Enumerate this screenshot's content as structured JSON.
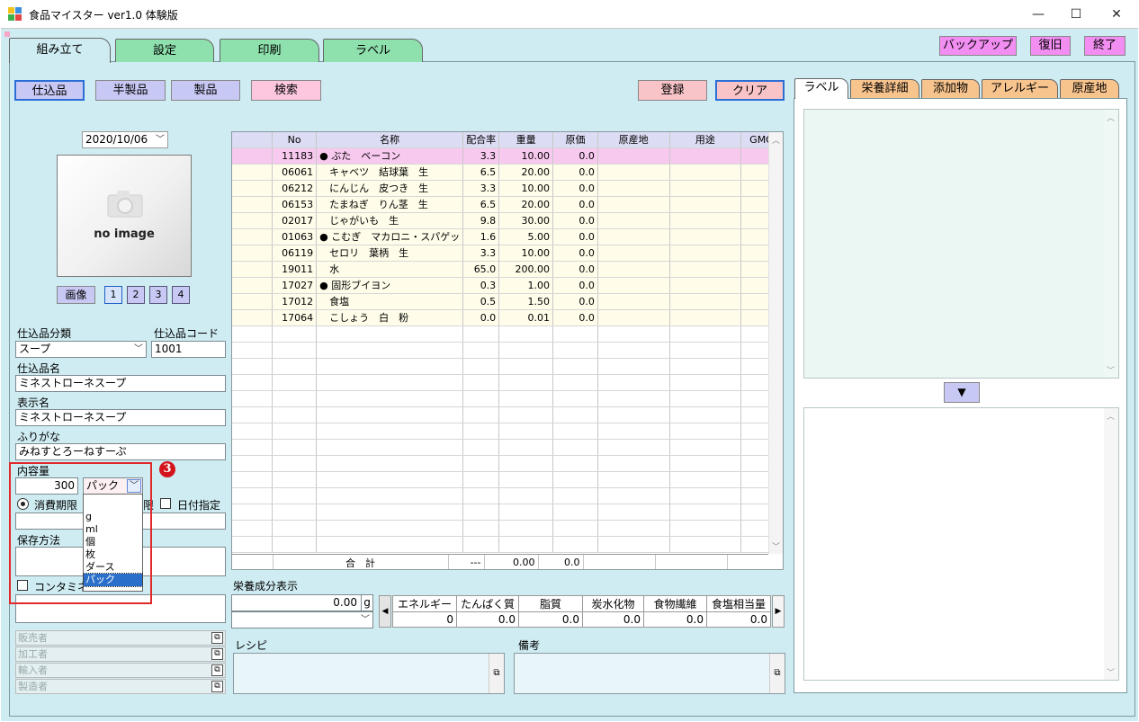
{
  "window": {
    "title": "食品マイスター ver1.0 体験版",
    "minimize": "—",
    "maximize": "☐",
    "close": "✕"
  },
  "tabs": [
    {
      "label": "組み立て",
      "active": true
    },
    {
      "label": "設定"
    },
    {
      "label": "印刷"
    },
    {
      "label": "ラベル"
    }
  ],
  "top_buttons": {
    "backup": "バックアップ",
    "restore": "復旧",
    "exit": "終了"
  },
  "toolbar": {
    "shikomi": "仕込品",
    "hanseihin": "半製品",
    "seihin": "製品",
    "search": "検索",
    "register": "登録",
    "clear": "クリア"
  },
  "date": "2020/10/06",
  "image": {
    "placeholder": "no image",
    "button": "画像",
    "pages": [
      "1",
      "2",
      "3",
      "4"
    ]
  },
  "form": {
    "category_label": "仕込品分類",
    "category_value": "スープ",
    "code_label": "仕込品コード",
    "code_value": "1001",
    "name_label": "仕込品名",
    "name_value": "ミネストローネスープ",
    "display_label": "表示名",
    "display_value": "ミネストローネスープ",
    "furigana_label": "ふりがな",
    "furigana_value": "みねすとろーねすーぷ",
    "content_label": "内容量",
    "content_value": "300",
    "unit_value": "パック",
    "expiry_label": "消費期限",
    "expiry_tail": "限",
    "date_spec_label": "日付指定",
    "storage_label": "保存方法",
    "contam_label": "コンタミネ",
    "marker": "3"
  },
  "unit_options": [
    "g",
    "ml",
    "個",
    "枚",
    "ダース",
    "パック"
  ],
  "roles": [
    "販売者",
    "加工者",
    "輸入者",
    "製造者"
  ],
  "grid": {
    "columns": [
      "",
      "No",
      "名称",
      "配合率",
      "重量",
      "原価",
      "原産地",
      "用途",
      "GMO"
    ],
    "rows": [
      {
        "no": "11183",
        "name": "● ぶた　ベーコン",
        "rate": "3.3",
        "weight": "10.00",
        "cost": "0.0"
      },
      {
        "no": "06061",
        "name": "　キャベツ　結球葉　生",
        "rate": "6.5",
        "weight": "20.00",
        "cost": "0.0"
      },
      {
        "no": "06212",
        "name": "　にんじん　皮つき　生",
        "rate": "3.3",
        "weight": "10.00",
        "cost": "0.0"
      },
      {
        "no": "06153",
        "name": "　たまねぎ　りん茎　生",
        "rate": "6.5",
        "weight": "20.00",
        "cost": "0.0"
      },
      {
        "no": "02017",
        "name": "　じゃがいも　生",
        "rate": "9.8",
        "weight": "30.00",
        "cost": "0.0"
      },
      {
        "no": "01063",
        "name": "● こむぎ　マカロニ・スパゲッ",
        "rate": "1.6",
        "weight": "5.00",
        "cost": "0.0"
      },
      {
        "no": "06119",
        "name": "　セロリ　葉柄　生",
        "rate": "3.3",
        "weight": "10.00",
        "cost": "0.0"
      },
      {
        "no": "19011",
        "name": "　水",
        "rate": "65.0",
        "weight": "200.00",
        "cost": "0.0"
      },
      {
        "no": "17027",
        "name": "● 固形ブイヨン",
        "rate": "0.3",
        "weight": "1.00",
        "cost": "0.0"
      },
      {
        "no": "17012",
        "name": "　食塩",
        "rate": "0.5",
        "weight": "1.50",
        "cost": "0.0"
      },
      {
        "no": "17064",
        "name": "　こしょう　白　粉",
        "rate": "0.0",
        "weight": "0.01",
        "cost": "0.0"
      }
    ],
    "total_label": "合　計",
    "total_rate": "---",
    "total_weight": "0.00",
    "total_cost": "0.0"
  },
  "nutrition": {
    "label": "栄養成分表示",
    "amount": "0.00",
    "unit": "g",
    "headers": [
      "エネルギー",
      "たんぱく質",
      "脂質",
      "炭水化物",
      "食物繊維",
      "食塩相当量"
    ],
    "values": [
      "0",
      "0.0",
      "0.0",
      "0.0",
      "0.0",
      "0.0"
    ]
  },
  "recipe_label": "レシピ",
  "notes_label": "備考",
  "right_tabs": [
    {
      "label": "ラベル",
      "active": true
    },
    {
      "label": "栄養詳細"
    },
    {
      "label": "添加物"
    },
    {
      "label": "アレルギー"
    },
    {
      "label": "原産地"
    }
  ]
}
